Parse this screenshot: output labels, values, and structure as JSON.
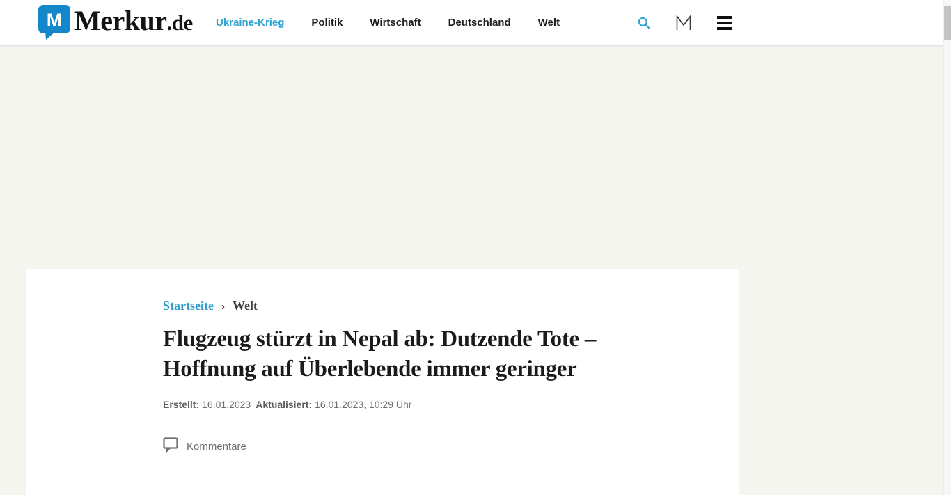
{
  "header": {
    "logo": {
      "name": "Merkur",
      "suffix": ".de",
      "icon_letter": "M"
    },
    "nav": [
      {
        "label": "Ukraine-Krieg",
        "active": true
      },
      {
        "label": "Politik",
        "active": false
      },
      {
        "label": "Wirtschaft",
        "active": false
      },
      {
        "label": "Deutschland",
        "active": false
      },
      {
        "label": "Welt",
        "active": false
      }
    ],
    "icons": {
      "search": "search-icon",
      "account": "merkur-account-m-icon",
      "menu": "hamburger-menu-icon"
    }
  },
  "article": {
    "breadcrumb": {
      "home": "Startseite",
      "separator": "›",
      "section": "Welt"
    },
    "headline": "Flugzeug stürzt in Nepal ab: Dutzende Tote – Hoffnung auf Überlebende immer geringer",
    "meta": {
      "created_label": "Erstellt:",
      "created_value": "16.01.2023",
      "updated_label": "Aktualisiert:",
      "updated_value": "16.01.2023, 10:29 Uhr"
    },
    "comments_label": "Kommentare"
  },
  "colors": {
    "accent": "#2ba4d3",
    "link": "#2b9cca",
    "logo_blue": "#1487cb",
    "background": "#f5f5f0",
    "headline_text": "#1b1b19",
    "nav_text": "#1d1d1b",
    "meta_text": "#6d6d6d",
    "divider": "#d9d9d9",
    "comment_text": "#6e6e6e"
  }
}
